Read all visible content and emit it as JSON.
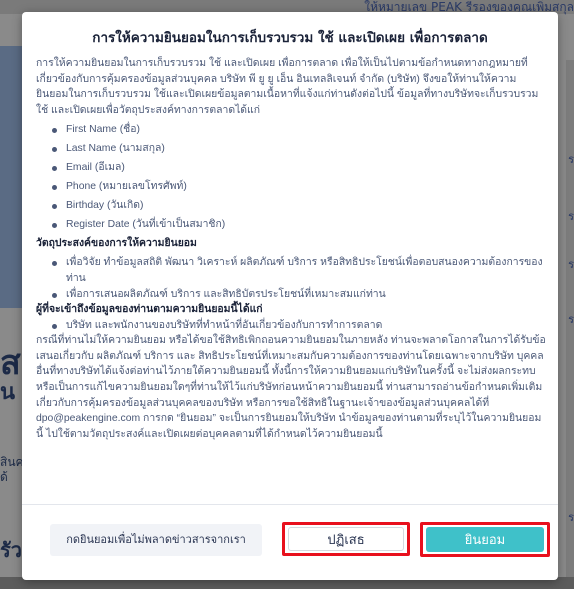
{
  "background": {
    "top_right_text": "ให้หมายเลข PEAK รีรองของคุณเพิ่มสกุล",
    "left_heading": "สดิ",
    "left_subheading": "น",
    "left_small_lines": [
      "สินค",
      "ด้"
    ],
    "left_bottom_text": "รัว",
    "right_marks": [
      "ร",
      "ร",
      "ร",
      "ร",
      "ร"
    ]
  },
  "modal": {
    "title": "การให้ความยินยอมในการเก็บรวบรวม ใช้ และเปิดเผย เพื่อการตลาด",
    "intro": "การให้ความยินยอมในการเก็บรวบรวม ใช้ และเปิดเผย เพื่อการตลาด เพื่อให้เป็นไปตามข้อกำหนดทางกฎหมายที่เกี่ยวข้องกับการคุ้มครองข้อมูลส่วนบุคคล บริษัท พี ยู ยู เอ็น อินเทลลิเจนท์ จำกัด (บริษัท) จึงขอให้ท่านให้ความยินยอมในการเก็บรวบรวม ใช้และเปิดเผยข้อมูลตามเนื้อหาที่แจ้งแก่ท่านดังต่อไปนี้ ข้อมูลที่ทางบริษัทจะเก็บรวบรวม ใช้ และเปิดเผยเพื่อวัตถุประสงค์ทางการตลาดได้แก่",
    "fields": [
      "First Name (ชื่อ)",
      "Last Name (นามสกุล)",
      "Email (อีเมล)",
      "Phone (หมายเลขโทรศัพท์)",
      "Birthday (วันเกิด)",
      "Register Date (วันที่เข้าเป็นสมาชิก)"
    ],
    "purpose_heading": "วัตถุประสงค์ของการให้ความยินยอม",
    "purposes": [
      "เพื่อวิจัย ทำข้อมูลสถิติ พัฒนา วิเคราะห์ ผลิตภัณฑ์ บริการ หรือสิทธิประโยชน์เพื่อตอบสนองความต้องการของท่าน",
      "เพื่อการเสนอผลิตภัณฑ์ บริการ และสิทธิบัตรประโยชน์ที่เหมาะสมแก่ท่าน"
    ],
    "recipients_heading": "ผู้ที่จะเข้าถึงข้อมูลของท่านตามความยินยอมนี้ได้แก่",
    "recipients": [
      "บริษัท และพนักงานของบริษัทที่ทำหน้าที่อันเกี่ยวข้องกับการทำการตลาด"
    ],
    "closing": "กรณีที่ท่านไม่ให้ความยินยอม หรือได้ขอใช้สิทธิเพิกถอนความยินยอมในภายหลัง ท่านจะพลาดโอกาสในการได้รับข้อเสนอเกี่ยวกับ ผลิตภัณฑ์ บริการ และ สิทธิประโยชน์ที่เหมาะสมกับความต้องการของท่านโดยเฉพาะจากบริษัท บุคคลอื่นที่ทางบริษัทได้แจ้งต่อท่านไว้ภายใต้ความยินยอมนี้ ทั้งนี้การให้ความยินยอมแก่บริษัทในครั้งนี้ จะไม่ส่งผลกระทบ หรือเป็นการแก้ไขความยินยอมใดๆที่ท่านให้ไว้แก่บริษัทก่อนหน้าความยินยอมนี้ ท่านสามารถอ่านข้อกำหนดเพิ่มเติมเกี่ยวกับการคุ้มครองข้อมูลส่วนบุคคลของบริษัท หรือการขอใช้สิทธิในฐานะเจ้าของข้อมูลส่วนบุคคลได้ที่ dpo@peakengine.com การกด “ยินยอม” จะเป็นการยินยอมให้บริษัท นำข้อมูลของท่านตามที่ระบุไว้ในความยินยอมนี้ ไปใช้ตามวัตถุประสงค์และเปิดเผยต่อบุคคลตามที่ได้กำหนดไว้ความยินยอมนี้"
  },
  "footer": {
    "newsletter_label": "กดยินยอมเพื่อไม่พลาดข่าวสารจากเรา",
    "reject_label": "ปฏิเสธ",
    "accept_label": "ยินยอม"
  },
  "colors": {
    "accent": "#3fc1c9",
    "highlight_border": "#e8101d",
    "title_text": "#1a2238",
    "body_text": "#4a5877"
  }
}
